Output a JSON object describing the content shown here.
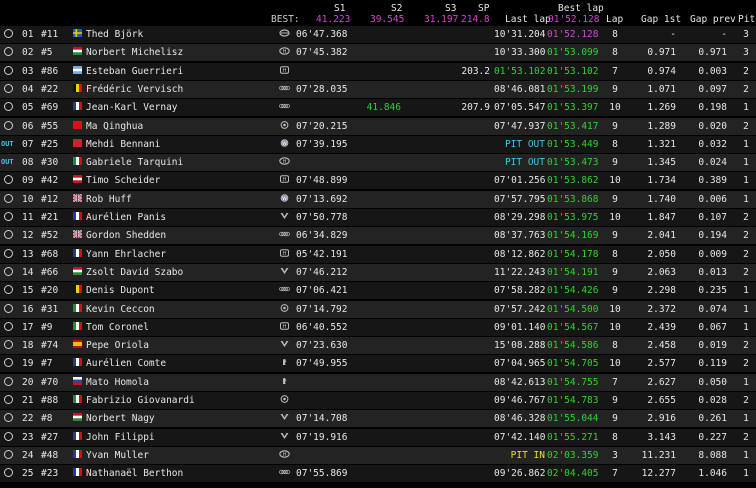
{
  "header": {
    "best_label": "BEST:",
    "s1_label": "S1",
    "s2_label": "S2",
    "s3_label": "S3",
    "sp_label": "SP",
    "best_s1": "41.223",
    "best_s2": "39.545",
    "best_s3": "31.197",
    "best_sp": "214.8",
    "last_lap_label": "Last lap",
    "best_lap_label": "Best lap",
    "best_lap_value": "01'52.128",
    "lap_label": "Lap",
    "gap_1st_label": "Gap 1st",
    "gap_prev_label": "Gap prev",
    "pit_label": "Pit"
  },
  "colors": {
    "green": "#2fd12f",
    "purple": "#d445d4",
    "pit_cyan": "#3ec7e8",
    "pit_yellow": "#e6e02a"
  },
  "rows": [
    {
      "status": "circle",
      "pos": "01",
      "num": "#11",
      "flag": "SE",
      "name": "Thed Björk",
      "brand": "volvo",
      "s1": "06'47.368",
      "s2": "",
      "s3": "",
      "sp": "",
      "last": "10'31.204",
      "best": "01'52.128",
      "lap": "8",
      "gap1": "-",
      "gapp": "-",
      "pit": "3",
      "last_color": "white",
      "best_color": "purple"
    },
    {
      "status": "circle",
      "pos": "02",
      "num": "#5",
      "flag": "HU",
      "name": "Norbert Michelisz",
      "brand": "hyundai",
      "s1": "07'45.382",
      "s2": "",
      "s3": "",
      "sp": "",
      "last": "10'33.300",
      "best": "01'53.099",
      "lap": "8",
      "gap1": "0.971",
      "gapp": "0.971",
      "pit": "3",
      "last_color": "white",
      "best_color": "green"
    },
    {
      "status": "circle",
      "pos": "03",
      "num": "#86",
      "flag": "AR",
      "name": "Esteban Guerrieri",
      "brand": "honda",
      "s1": "",
      "s2": "",
      "s3": "",
      "sp": "203.2",
      "last": "01'53.102",
      "best": "01'53.102",
      "lap": "7",
      "gap1": "0.974",
      "gapp": "0.003",
      "pit": "2",
      "last_color": "green",
      "best_color": "green"
    },
    {
      "status": "circle",
      "pos": "04",
      "num": "#22",
      "flag": "BE",
      "name": "Frédéric Vervisch",
      "brand": "audi",
      "s1": "07'28.035",
      "s2": "",
      "s3": "",
      "sp": "",
      "last": "08'46.081",
      "best": "01'53.199",
      "lap": "9",
      "gap1": "1.071",
      "gapp": "0.097",
      "pit": "2",
      "last_color": "white",
      "best_color": "green"
    },
    {
      "status": "circle",
      "pos": "05",
      "num": "#69",
      "flag": "FR",
      "name": "Jean-Karl Vernay",
      "brand": "audi",
      "s1": "",
      "s2": "41.846",
      "s3": "",
      "sp": "207.9",
      "last": "07'05.547",
      "best": "01'53.397",
      "lap": "10",
      "gap1": "1.269",
      "gapp": "0.198",
      "pit": "1",
      "last_color": "white",
      "best_color": "green"
    },
    {
      "status": "circle",
      "pos": "06",
      "num": "#55",
      "flag": "CN",
      "name": "Ma Qinghua",
      "brand": "alfa",
      "s1": "07'20.215",
      "s2": "",
      "s3": "",
      "sp": "",
      "last": "07'47.937",
      "best": "01'53.417",
      "lap": "9",
      "gap1": "1.289",
      "gapp": "0.020",
      "pit": "2",
      "last_color": "white",
      "best_color": "green"
    },
    {
      "status": "out",
      "pos": "07",
      "num": "#25",
      "flag": "MA",
      "name": "Mehdi Bennani",
      "brand": "vw",
      "s1": "07'39.195",
      "s2": "",
      "s3": "",
      "sp": "",
      "last": "PIT OUT",
      "best": "01'53.449",
      "lap": "8",
      "gap1": "1.321",
      "gapp": "0.032",
      "pit": "1",
      "last_color": "cyan",
      "best_color": "green"
    },
    {
      "status": "out",
      "pos": "08",
      "num": "#30",
      "flag": "IT",
      "name": "Gabriele Tarquini",
      "brand": "hyundai",
      "s1": "",
      "s2": "",
      "s3": "",
      "sp": "",
      "last": "PIT OUT",
      "best": "01'53.473",
      "lap": "9",
      "gap1": "1.345",
      "gapp": "0.024",
      "pit": "1",
      "last_color": "cyan",
      "best_color": "green"
    },
    {
      "status": "circle",
      "pos": "09",
      "num": "#42",
      "flag": "AT",
      "name": "Timo Scheider",
      "brand": "honda",
      "s1": "07'48.899",
      "s2": "",
      "s3": "",
      "sp": "",
      "last": "07'01.256",
      "best": "01'53.862",
      "lap": "10",
      "gap1": "1.734",
      "gapp": "0.389",
      "pit": "1",
      "last_color": "white",
      "best_color": "green"
    },
    {
      "status": "circle",
      "pos": "10",
      "num": "#12",
      "flag": "GB",
      "name": "Rob Huff",
      "brand": "vw",
      "s1": "07'13.692",
      "s2": "",
      "s3": "",
      "sp": "",
      "last": "07'57.795",
      "best": "01'53.868",
      "lap": "9",
      "gap1": "1.740",
      "gapp": "0.006",
      "pit": "1",
      "last_color": "white",
      "best_color": "green"
    },
    {
      "status": "circle",
      "pos": "11",
      "num": "#21",
      "flag": "FR",
      "name": "Aurélien Panis",
      "brand": "cupra",
      "s1": "07'50.778",
      "s2": "",
      "s3": "",
      "sp": "",
      "last": "08'29.298",
      "best": "01'53.975",
      "lap": "10",
      "gap1": "1.847",
      "gapp": "0.107",
      "pit": "2",
      "last_color": "white",
      "best_color": "green"
    },
    {
      "status": "circle",
      "pos": "12",
      "num": "#52",
      "flag": "GB",
      "name": "Gordon Shedden",
      "brand": "audi",
      "s1": "06'34.829",
      "s2": "",
      "s3": "",
      "sp": "",
      "last": "08'37.763",
      "best": "01'54.169",
      "lap": "9",
      "gap1": "2.041",
      "gapp": "0.194",
      "pit": "2",
      "last_color": "white",
      "best_color": "green"
    },
    {
      "status": "circle",
      "pos": "13",
      "num": "#68",
      "flag": "FR",
      "name": "Yann Ehrlacher",
      "brand": "honda",
      "s1": "05'42.191",
      "s2": "",
      "s3": "",
      "sp": "",
      "last": "08'12.862",
      "best": "01'54.178",
      "lap": "8",
      "gap1": "2.050",
      "gapp": "0.009",
      "pit": "2",
      "last_color": "white",
      "best_color": "green"
    },
    {
      "status": "circle",
      "pos": "14",
      "num": "#66",
      "flag": "HU",
      "name": "Zsolt David Szabo",
      "brand": "cupra",
      "s1": "07'46.212",
      "s2": "",
      "s3": "",
      "sp": "",
      "last": "11'22.243",
      "best": "01'54.191",
      "lap": "9",
      "gap1": "2.063",
      "gapp": "0.013",
      "pit": "2",
      "last_color": "white",
      "best_color": "green"
    },
    {
      "status": "circle",
      "pos": "15",
      "num": "#20",
      "flag": "BE",
      "name": "Denis Dupont",
      "brand": "audi",
      "s1": "07'06.421",
      "s2": "",
      "s3": "",
      "sp": "",
      "last": "07'58.282",
      "best": "01'54.426",
      "lap": "9",
      "gap1": "2.298",
      "gapp": "0.235",
      "pit": "1",
      "last_color": "white",
      "best_color": "green"
    },
    {
      "status": "circle",
      "pos": "16",
      "num": "#31",
      "flag": "IT",
      "name": "Kevin Ceccon",
      "brand": "alfa",
      "s1": "07'14.792",
      "s2": "",
      "s3": "",
      "sp": "",
      "last": "07'57.242",
      "best": "01'54.500",
      "lap": "10",
      "gap1": "2.372",
      "gapp": "0.074",
      "pit": "1",
      "last_color": "white",
      "best_color": "green"
    },
    {
      "status": "circle",
      "pos": "17",
      "num": "#9",
      "flag": "IT",
      "name": "Tom Coronel",
      "brand": "honda",
      "s1": "06'40.552",
      "s2": "",
      "s3": "",
      "sp": "",
      "last": "09'01.140",
      "best": "01'54.567",
      "lap": "10",
      "gap1": "2.439",
      "gapp": "0.067",
      "pit": "1",
      "last_color": "white",
      "best_color": "green"
    },
    {
      "status": "circle",
      "pos": "18",
      "num": "#74",
      "flag": "ES",
      "name": "Pepe Oriola",
      "brand": "cupra",
      "s1": "07'23.630",
      "s2": "",
      "s3": "",
      "sp": "",
      "last": "15'08.288",
      "best": "01'54.586",
      "lap": "8",
      "gap1": "2.458",
      "gapp": "0.019",
      "pit": "2",
      "last_color": "white",
      "best_color": "green"
    },
    {
      "status": "circle",
      "pos": "19",
      "num": "#7",
      "flag": "FR",
      "name": "Aurélien Comte",
      "brand": "peugeot",
      "s1": "07'49.955",
      "s2": "",
      "s3": "",
      "sp": "",
      "last": "07'04.965",
      "best": "01'54.705",
      "lap": "10",
      "gap1": "2.577",
      "gapp": "0.119",
      "pit": "2",
      "last_color": "white",
      "best_color": "green"
    },
    {
      "status": "circle",
      "pos": "20",
      "num": "#70",
      "flag": "SK",
      "name": "Mato Homola",
      "brand": "peugeot",
      "s1": "",
      "s2": "",
      "s3": "",
      "sp": "",
      "last": "08'42.613",
      "best": "01'54.755",
      "lap": "7",
      "gap1": "2.627",
      "gapp": "0.050",
      "pit": "1",
      "last_color": "white",
      "best_color": "green"
    },
    {
      "status": "circle",
      "pos": "21",
      "num": "#88",
      "flag": "IT",
      "name": "Fabrizio Giovanardi",
      "brand": "alfa",
      "s1": "",
      "s2": "",
      "s3": "",
      "sp": "",
      "last": "09'46.767",
      "best": "01'54.783",
      "lap": "9",
      "gap1": "2.655",
      "gapp": "0.028",
      "pit": "2",
      "last_color": "white",
      "best_color": "green"
    },
    {
      "status": "circle",
      "pos": "22",
      "num": "#8",
      "flag": "HU",
      "name": "Norbert Nagy",
      "brand": "cupra",
      "s1": "07'14.708",
      "s2": "",
      "s3": "",
      "sp": "",
      "last": "08'46.328",
      "best": "01'55.044",
      "lap": "9",
      "gap1": "2.916",
      "gapp": "0.261",
      "pit": "1",
      "last_color": "white",
      "best_color": "green"
    },
    {
      "status": "circle",
      "pos": "23",
      "num": "#27",
      "flag": "FR",
      "name": "John Filippi",
      "brand": "cupra",
      "s1": "07'19.916",
      "s2": "",
      "s3": "",
      "sp": "",
      "last": "07'42.140",
      "best": "01'55.271",
      "lap": "8",
      "gap1": "3.143",
      "gapp": "0.227",
      "pit": "2",
      "last_color": "white",
      "best_color": "green"
    },
    {
      "status": "circle",
      "pos": "24",
      "num": "#48",
      "flag": "FR",
      "name": "Yvan Muller",
      "brand": "hyundai",
      "s1": "",
      "s2": "",
      "s3": "",
      "sp": "",
      "last": "PIT IN",
      "best": "02'03.359",
      "lap": "3",
      "gap1": "11.231",
      "gapp": "8.088",
      "pit": "1",
      "last_color": "yellow",
      "best_color": "green"
    },
    {
      "status": "circle",
      "pos": "25",
      "num": "#23",
      "flag": "FR",
      "name": "Nathanaël Berthon",
      "brand": "audi",
      "s1": "07'55.869",
      "s2": "",
      "s3": "",
      "sp": "",
      "last": "09'26.862",
      "best": "02'04.405",
      "lap": "7",
      "gap1": "12.277",
      "gapp": "1.046",
      "pit": "1",
      "last_color": "white",
      "best_color": "green"
    }
  ]
}
